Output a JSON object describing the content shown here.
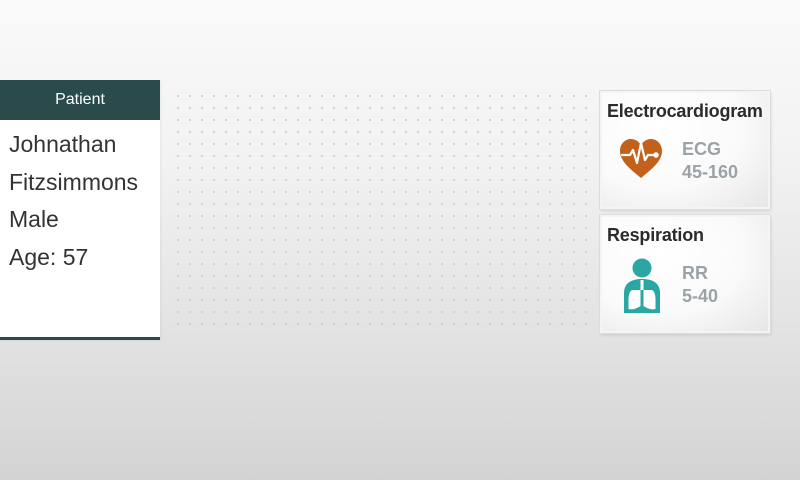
{
  "patient": {
    "header": "Patient",
    "first_name": "Johnathan",
    "last_name": "Fitzsimmons",
    "sex": "Male",
    "age": "Age: 57"
  },
  "vitals": [
    {
      "title": "Electrocardiogram",
      "code": "ECG",
      "range": "45-160",
      "icon": "heart-pulse-icon",
      "color": "#c2611a"
    },
    {
      "title": "Respiration",
      "code": "RR",
      "range": "5-40",
      "icon": "person-lungs-icon",
      "color": "#2aa7a5"
    }
  ],
  "colors": {
    "header_bg": "#2a4a4c",
    "muted_text": "#9aa3a8"
  }
}
